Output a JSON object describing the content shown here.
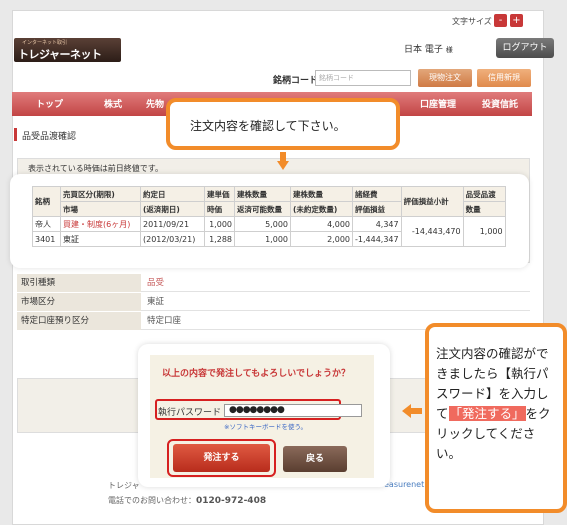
{
  "header": {
    "font_size_label": "文字サイズ",
    "font_minus": "-",
    "font_plus": "+",
    "logo_small": "インターネット取引",
    "logo_main": "トレジャーネット",
    "user_name": "日本 電子",
    "user_suffix": "様",
    "logout": "ログアウト"
  },
  "order_bar": {
    "code_label": "銘柄コード",
    "code_placeholder": "銘柄コード",
    "spot_order": "現物注文",
    "margin_new": "信用新規"
  },
  "nav": [
    "トップ",
    "株式",
    "先物",
    "口座管理",
    "投資信託"
  ],
  "page_title": "品受品渡確認",
  "info_text": "表示されている時価は前日終値です。",
  "table": {
    "headers": [
      [
        "銘柄",
        ""
      ],
      [
        "売買区分(期限)",
        "市場"
      ],
      [
        "約定日",
        "(返済期日)"
      ],
      [
        "建単価",
        "時価"
      ],
      [
        "建株数量",
        "返済可能数量"
      ],
      [
        "建株数量",
        "(未約定数量)"
      ],
      [
        "諸経費",
        "評価損益"
      ],
      [
        "評価損益小計",
        ""
      ],
      [
        "品受品渡",
        "数量"
      ]
    ],
    "row1": [
      "帝人",
      "買建・制度(6ヶ月)",
      "2011/09/21",
      "1,000",
      "5,000",
      "4,000",
      "4,347",
      "-14,443,470",
      "1,000"
    ],
    "row2": [
      "3401",
      "東証",
      "(2012/03/21)",
      "1,288",
      "1,000",
      "2,000",
      "-1,444,347",
      "",
      ""
    ]
  },
  "details": [
    {
      "label": "取引種類",
      "value": "品受"
    },
    {
      "label": "市場区分",
      "value": "東証"
    },
    {
      "label": "特定口座預り区分",
      "value": "特定口座"
    }
  ],
  "confirm": {
    "question": "以上の内容で発注してもよろしいでしょうか？",
    "password_label": "執行パスワード",
    "password_value": "●●●●●●●●",
    "soft_keyboard": "※ソフトキーボードを使う。",
    "submit": "発注する",
    "back": "戻る"
  },
  "footer": {
    "company": "トレジャ",
    "tel_label": "電話でのお問い合わせ：",
    "tel": "0120-972-408",
    "url": "easurenet"
  },
  "callouts": {
    "top": "注文内容を確認して下さい。",
    "side_1": "注文内容の確認ができましたら【執行パスワード】を入力して",
    "side_hl": "「発注する」",
    "side_2": "をクリックしてください。"
  },
  "colors": {
    "brand_red": "#c83838",
    "callout_orange": "#f28c2a",
    "highlight_red": "#d62020"
  }
}
